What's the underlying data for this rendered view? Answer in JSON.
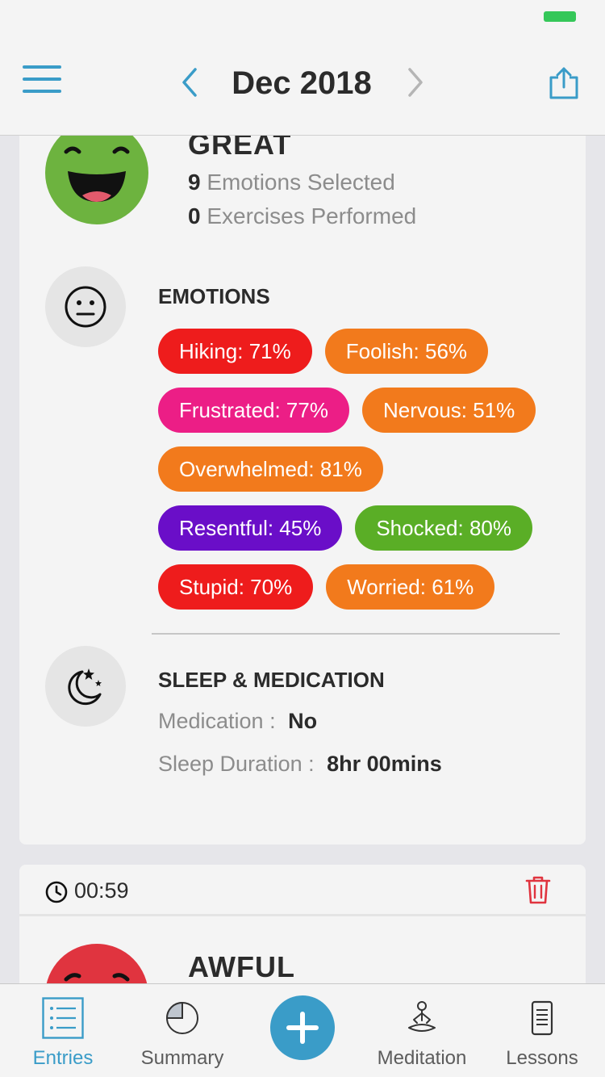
{
  "header": {
    "title": "Dec 2018",
    "menu_icon": "hamburger-menu-icon",
    "prev_icon": "chevron-left-icon",
    "next_icon": "chevron-right-icon",
    "share_icon": "share-icon"
  },
  "entry1": {
    "mood": "GREAT",
    "mood_color": "#6db33f",
    "emotions_count": "9",
    "emotions_text": "Emotions Selected",
    "exercises_count": "0",
    "exercises_text": "Exercises Performed",
    "emotions_section_title": "EMOTIONS",
    "emotions": [
      {
        "label": "Hiking: 71%",
        "color": "#ee1c1c"
      },
      {
        "label": "Foolish: 56%",
        "color": "#f27a1c"
      },
      {
        "label": "Frustrated: 77%",
        "color": "#ec1e86"
      },
      {
        "label": "Nervous: 51%",
        "color": "#f27a1c"
      },
      {
        "label": "Overwhelmed: 81%",
        "color": "#f27a1c"
      },
      {
        "label": "Resentful: 45%",
        "color": "#6a0ec8"
      },
      {
        "label": "Shocked: 80%",
        "color": "#5aae26"
      },
      {
        "label": "Stupid: 70%",
        "color": "#ee1c1c"
      },
      {
        "label": "Worried: 61%",
        "color": "#f27a1c"
      }
    ],
    "sleep_section_title": "SLEEP & MEDICATION",
    "medication_label": "Medication :",
    "medication_value": "No",
    "sleep_label": "Sleep Duration :",
    "sleep_value": "8hr 00mins"
  },
  "entry2": {
    "time": "00:59",
    "mood": "AWFUL",
    "mood_color": "#e0343f"
  },
  "tabs": [
    {
      "label": "Entries",
      "icon": "entries-list-icon",
      "active": true
    },
    {
      "label": "Summary",
      "icon": "pie-chart-icon",
      "active": false
    },
    {
      "label": "",
      "icon": "plus-icon",
      "active": false
    },
    {
      "label": "Meditation",
      "icon": "meditation-icon",
      "active": false
    },
    {
      "label": "Lessons",
      "icon": "phone-lessons-icon",
      "active": false
    }
  ],
  "colors": {
    "accent": "#3a9cc8",
    "trash": "#e0343f"
  }
}
